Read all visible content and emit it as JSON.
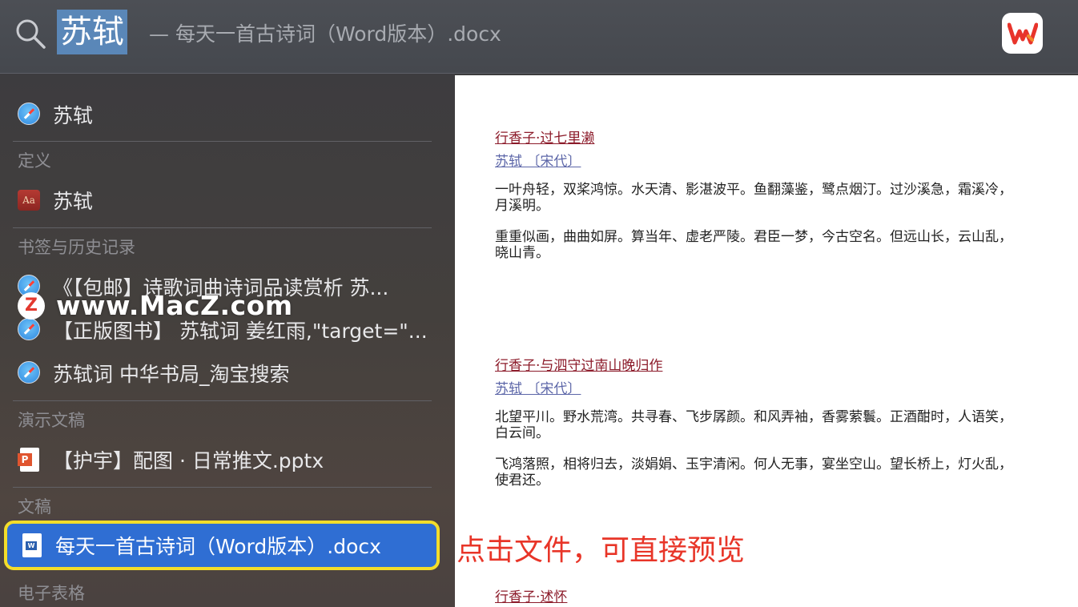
{
  "search": {
    "query": "苏轼",
    "suggestion": "— 每天一首古诗词（Word版本）.docx"
  },
  "colors": {
    "selection": "#2f6ed3",
    "highlight_border": "#f3dd2a",
    "annotation": "#e83528",
    "poem_title": "#8c1b2a"
  },
  "results": {
    "top_hit": {
      "icon": "safari-icon",
      "label": "苏轼"
    },
    "definition": {
      "header": "定义",
      "icon": "dictionary-icon",
      "label": "苏轼"
    },
    "bookmarks": {
      "header": "书签与历史记录",
      "items": [
        {
          "icon": "safari-icon",
          "label": "《【包邮】诗歌词曲诗词品读赏析 苏..."
        },
        {
          "icon": "safari-icon",
          "label": "【正版图书】 苏轼词 姜红雨,\"target=\"..."
        },
        {
          "icon": "safari-icon",
          "label": "苏轼词 中华书局_淘宝搜索"
        }
      ]
    },
    "presentations": {
      "header": "演示文稿",
      "icon": "ppt-icon",
      "label": "【护宇】配图 · 日常推文.pptx"
    },
    "documents": {
      "header": "文稿",
      "icon": "word-icon",
      "label": "每天一首古诗词（Word版本）.docx"
    },
    "spreadsheets": {
      "header": "电子表格"
    }
  },
  "watermark": {
    "logo": "Z",
    "text": "www.MacZ.com"
  },
  "annotation": "点击文件，可直接预览",
  "preview": {
    "poems": [
      {
        "title": "行香子·过七里濑",
        "author": "苏轼 〔宋代〕",
        "paragraphs": [
          "一叶舟轻，双桨鸿惊。水天清、影湛波平。鱼翻藻鉴，鹭点烟汀。过沙溪急，霜溪冷，月溪明。",
          "重重似画，曲曲如屏。算当年、虚老严陵。君臣一梦，今古空名。但远山长，云山乱，晓山青。"
        ]
      },
      {
        "title": "行香子·与泗守过南山晚归作",
        "author": "苏轼 〔宋代〕",
        "paragraphs": [
          "北望平川。野水荒湾。共寻春、飞步孱颜。和风弄袖，香雾萦鬟。正酒酣时，人语笑，白云间。",
          "飞鸿落照，相将归去，淡娟娟、玉宇清闲。何人无事，宴坐空山。望长桥上，灯火乱，使君还。"
        ]
      },
      {
        "title": "行香子·述怀"
      }
    ]
  }
}
